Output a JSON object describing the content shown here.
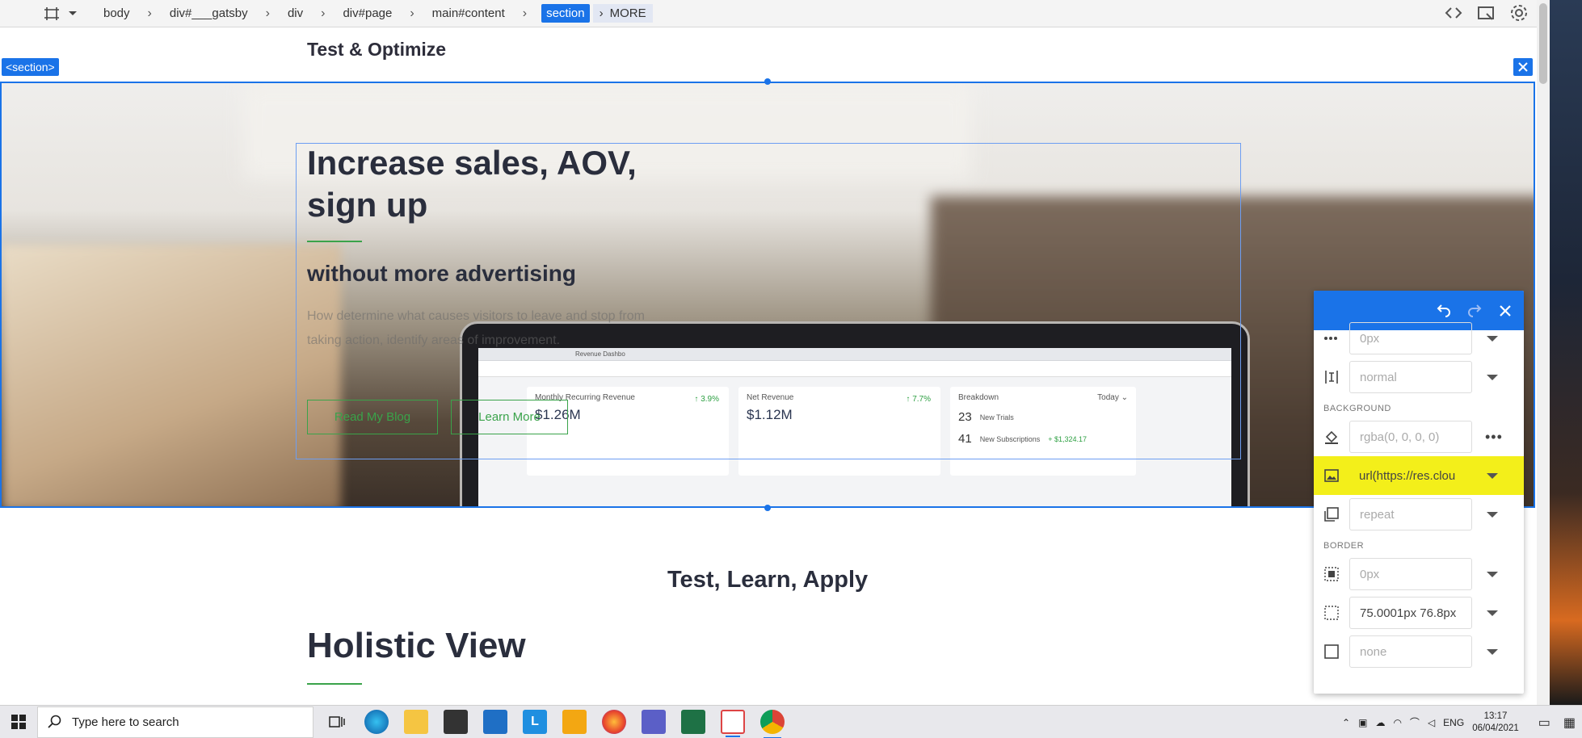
{
  "toolbar": {
    "crumbs": [
      "body",
      "div#___gatsby",
      "div",
      "div#page",
      "main#content"
    ],
    "active_crumb": "section",
    "more_label": "MORE"
  },
  "page": {
    "nav_title": "Test & Optimize",
    "section_tag": "<section>"
  },
  "hero": {
    "heading_line1": "Increase sales, AOV,",
    "heading_line2": "sign up",
    "subheading": "without more advertising",
    "paragraph": "How determine what causes visitors to leave and stop from taking action, identify areas of improvement.",
    "buttons": [
      "Read My Blog",
      "Learn More"
    ],
    "screen": {
      "tab_label": "Revenue Dashbo",
      "card1_label": "Monthly Recurring Revenue",
      "card1_value": "$1.26M",
      "card1_pct": "↑ 3.9%",
      "card2_label": "Net Revenue",
      "card2_value": "$1.12M",
      "card2_pct": "↑ 7.7%",
      "card3_label": "Breakdown",
      "card3_range": "Today ⌄",
      "row1_num": "23",
      "row1_label": "New Trials",
      "row2_num": "41",
      "row2_label": "New Subscriptions",
      "row2_amount": "+ $1,324.17"
    }
  },
  "below": {
    "subtitle": "Test, Learn, Apply",
    "holistic": "Holistic View"
  },
  "panel": {
    "spacing_value": "0px",
    "font_stretch": "normal",
    "bg_label": "BACKGROUND",
    "bg_color": "rgba(0, 0, 0, 0)",
    "bg_image": "url(https://res.clou",
    "bg_repeat": "repeat",
    "border_label": "BORDER",
    "border_width": "0px",
    "border_radius": "75.0001px 76.8px",
    "border_style": "none",
    "more_glyph": "•••",
    "highlight_color": "#f3ef1a"
  },
  "taskbar": {
    "search_placeholder": "Type here to search",
    "lang": "ENG",
    "time": "13:17",
    "date": "06/04/2021"
  },
  "colors": {
    "accent": "#1a73e8",
    "green": "#3aa34a"
  }
}
